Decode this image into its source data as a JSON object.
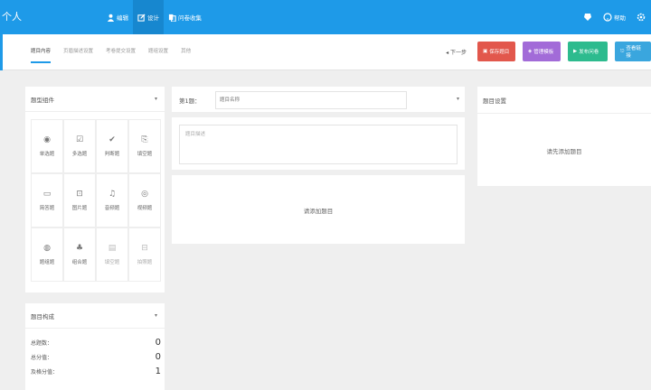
{
  "topbar": {
    "brand": "个人",
    "nav": [
      {
        "label": "编辑",
        "icon": "user-icon"
      },
      {
        "label": "设计",
        "icon": "edit-icon"
      },
      {
        "label": "问卷收集",
        "icon": "copy-icon"
      }
    ],
    "right": [
      {
        "icon": "skin-icon",
        "label": ""
      },
      {
        "icon": "help-icon",
        "label": "帮助"
      },
      {
        "icon": "settings-icon",
        "label": ""
      }
    ]
  },
  "tabs": [
    "题目内容",
    "页眉描述设置",
    "考卷提交设置",
    "题组设置",
    "其他"
  ],
  "subbar": {
    "nav_arrows": "◂ 下一步",
    "buttons": [
      {
        "label": "保存题目",
        "color": "#e2574c"
      },
      {
        "label": "管理模板",
        "color": "#a26bd8"
      },
      {
        "label": "发布问卷",
        "color": "#2dbb8e"
      },
      {
        "label": "查看链接",
        "color": "#3aa6de"
      }
    ]
  },
  "left_panel": {
    "title": "题型组件",
    "types": [
      {
        "label": "单选题",
        "icon": "◉"
      },
      {
        "label": "多选题",
        "icon": "☑"
      },
      {
        "label": "判断题",
        "icon": "✔"
      },
      {
        "label": "填空题",
        "icon": "⎘"
      },
      {
        "label": "简答题",
        "icon": "▭"
      },
      {
        "label": "图片题",
        "icon": "⊡"
      },
      {
        "label": "音频题",
        "icon": "♫"
      },
      {
        "label": "视频题",
        "icon": "◎"
      },
      {
        "label": "题组题",
        "icon": "◍"
      },
      {
        "label": "组合题",
        "icon": "♣"
      },
      {
        "label": "填空题",
        "icon": "▤"
      },
      {
        "label": "拍照题",
        "icon": "⊟"
      }
    ]
  },
  "stats_panel": {
    "title": "题目构成",
    "rows": [
      {
        "label": "总题数：",
        "value": "0"
      },
      {
        "label": "总分值：",
        "value": "0"
      },
      {
        "label": "及格分值：",
        "value": "1"
      }
    ]
  },
  "editor": {
    "label": "第1题：",
    "title_placeholder": "题目名称",
    "desc_placeholder": "题目描述",
    "add_text": "请添加题目"
  },
  "settings": {
    "title": "题目设置",
    "empty_text": "请先添加题目"
  }
}
